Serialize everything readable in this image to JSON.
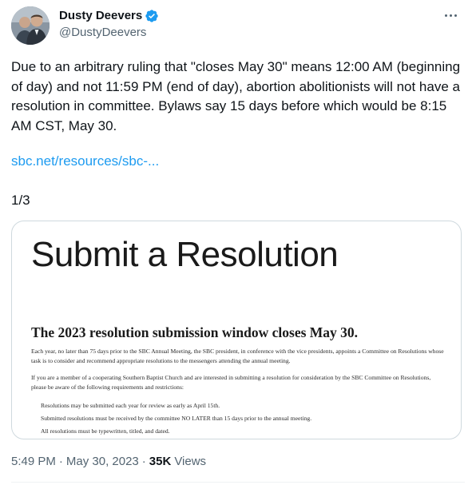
{
  "author": {
    "display_name": "Dusty Deevers",
    "handle": "@DustyDeevers",
    "verified": true
  },
  "icons": {
    "avatar": "profile-photo",
    "verified": "verified-badge-icon",
    "more": "more-options-icon"
  },
  "tweet": {
    "text": "Due to an arbitrary ruling that \"closes May 30\" means 12:00 AM (beginning of day) and not 11:59 PM (end of day), abortion abolitionists will not have a resolution in committee. Bylaws say 15 days before which would be 8:15 AM CST, May 30.",
    "link_text": "sbc.net/resources/sbc-...",
    "thread_count": "1/3"
  },
  "media": {
    "heading": "Submit a Resolution",
    "subheading": "The 2023 resolution submission window closes May 30.",
    "paragraph_1": "Each year, no later than 75 days prior to the SBC Annual Meeting, the SBC president, in conference with the vice presidents, appoints a Committee on Resolutions whose task is to consider and recommend appropriate resolutions to the messengers attending the annual meeting.",
    "paragraph_2": "If you are a member of a cooperating Southern Baptist Church and are interested in submitting a resolution for consideration by the SBC Committee on Resolutions, please be aware of the following requirements and restrictions:",
    "list": [
      "Resolutions may be submitted each year for review as early as April 15th.",
      "Submitted resolutions must be received by the committee NO LATER than 15 days prior to the annual meeting.",
      "All resolutions must be typewritten, titled, and dated."
    ]
  },
  "meta": {
    "time": "5:49 PM",
    "separator": "·",
    "date": "May 30, 2023",
    "views_count": "35K",
    "views_label": "Views"
  },
  "colors": {
    "link": "#1d9bf0",
    "secondary_text": "#536471",
    "verified_badge": "#1d9bf0",
    "border": "#cfd9de"
  }
}
